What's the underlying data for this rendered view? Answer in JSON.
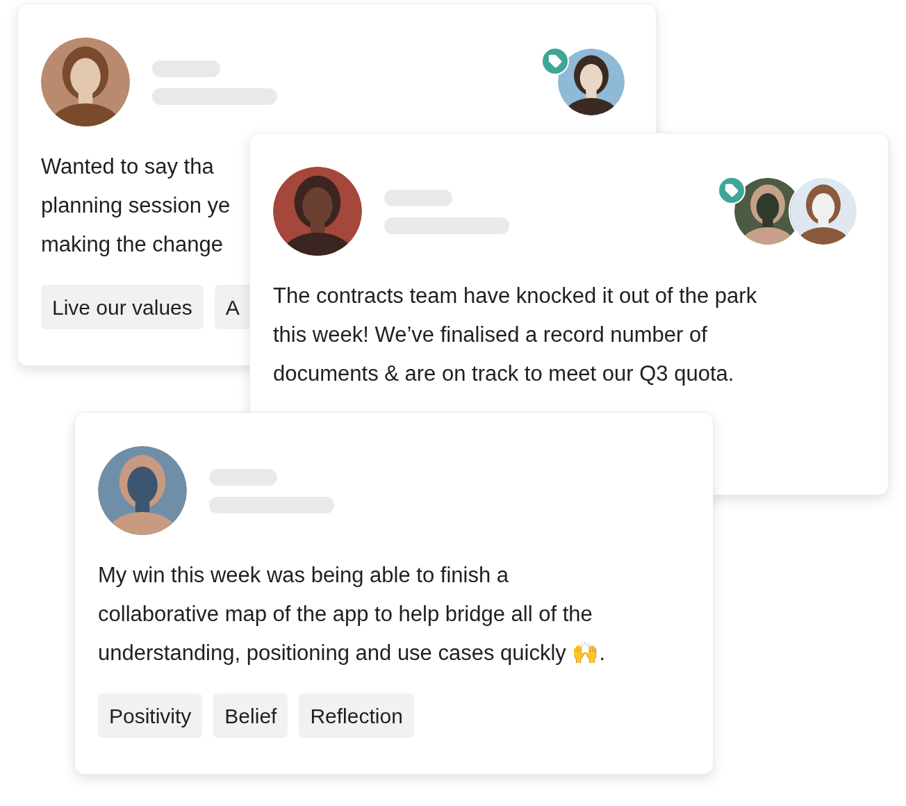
{
  "cards": [
    {
      "message_lines": [
        "Wanted to say tha",
        "planning session ye",
        "making the change"
      ],
      "tags": [
        "Live our values",
        "A"
      ]
    },
    {
      "message_lines": [
        "The contracts team have knocked it out of the park",
        "this week! We’ve finalised a record number of",
        "documents & are on track to meet our Q3 quota."
      ]
    },
    {
      "message_lines": [
        "My win this week was being able to finish a",
        "collaborative map of the app to help bridge all of the",
        "understanding, positioning and use cases quickly 🙌."
      ],
      "tags": [
        "Positivity",
        "Belief",
        "Reflection"
      ]
    }
  ]
}
